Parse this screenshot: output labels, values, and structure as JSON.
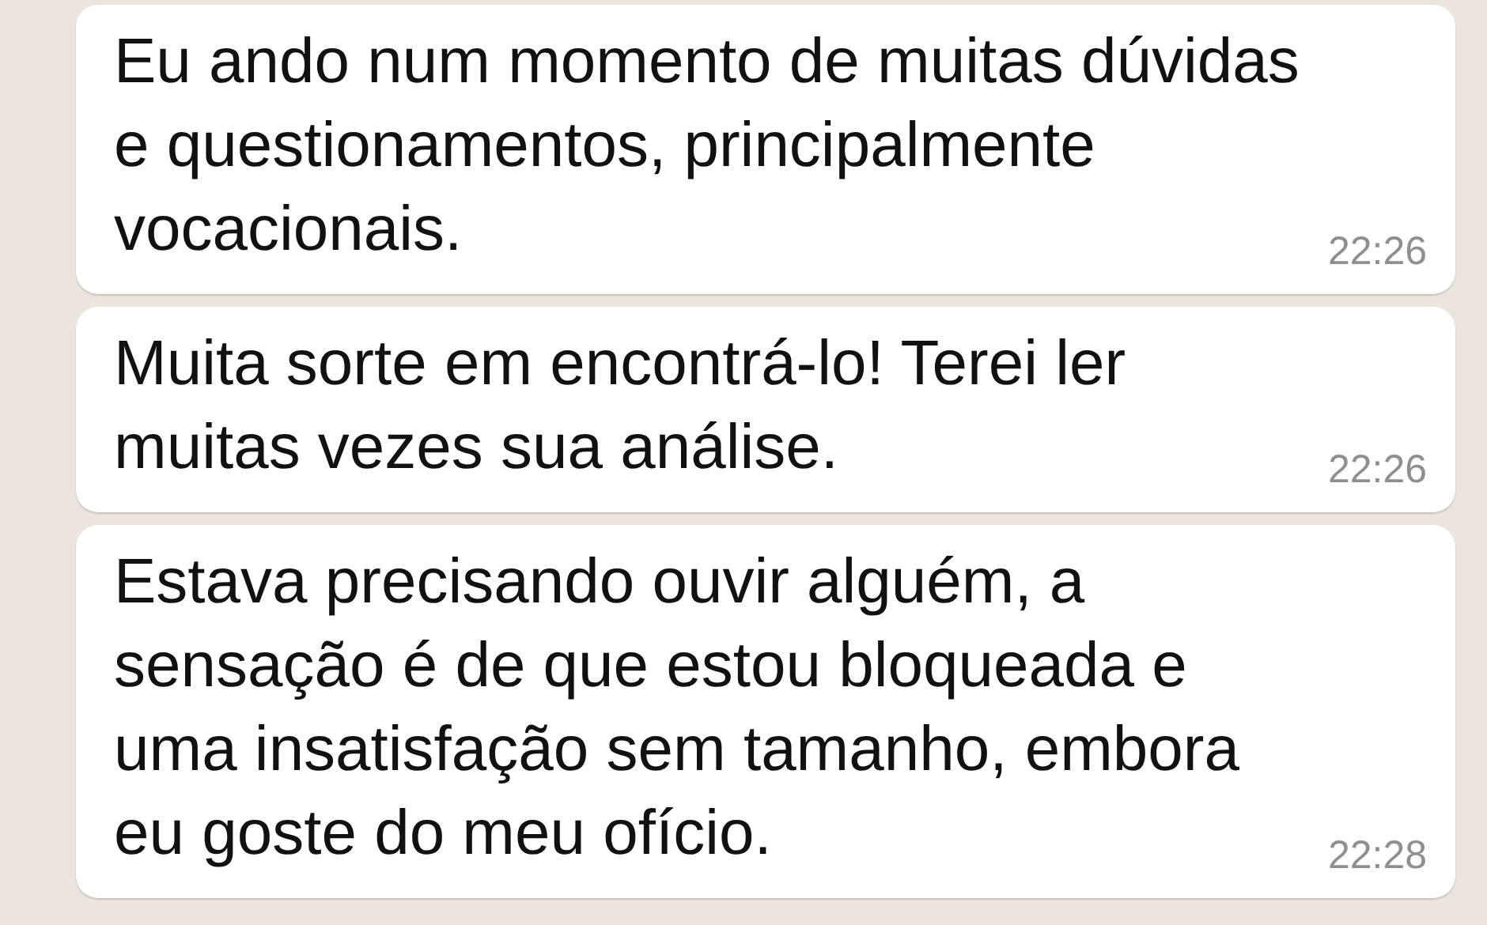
{
  "messages": [
    {
      "text": "Eu ando num momento de muitas dúvidas\ne questionamentos, principalmente\nvocacionais.",
      "time": "22:26"
    },
    {
      "text": "Muita sorte em encontrá-lo! Terei ler\nmuitas vezes sua análise.",
      "time": "22:26"
    },
    {
      "text": "Estava precisando ouvir alguém, a\nsensação é de que estou bloqueada e\numa insatisfação sem tamanho, embora\neu goste do meu ofício.",
      "time": "22:28"
    }
  ]
}
